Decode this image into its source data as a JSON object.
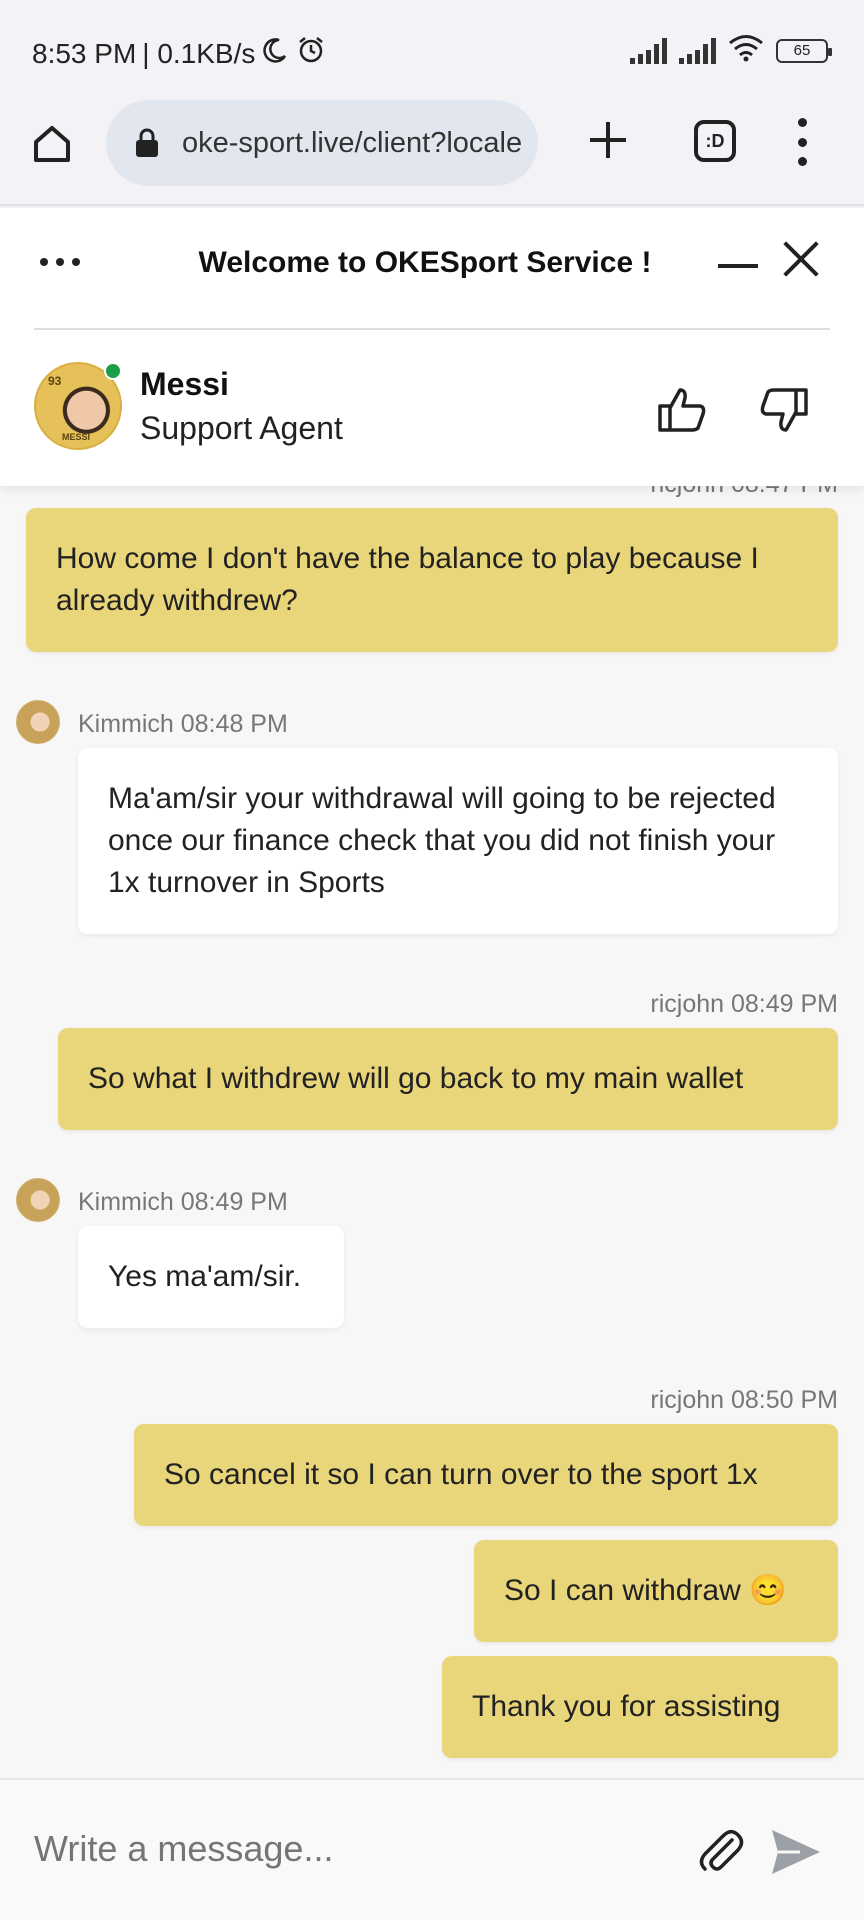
{
  "status_bar": {
    "time": "8:53 PM",
    "speed": "| 0.1KB/s",
    "battery": "65"
  },
  "browser": {
    "url": "oke-sport.live/client?locale",
    "tabs_label": ":D"
  },
  "chat_header": {
    "title": "Welcome to OKESport Service !",
    "agent_name": "Messi",
    "agent_role": "Support Agent",
    "agent_card_number": "93",
    "agent_card_name": "MESSI",
    "online_color": "#1a9e48"
  },
  "messages": {
    "partial_meta": "ricjohn 08:47 PM",
    "m1_text": "How come I don't have the balance to play because I already withdrew?",
    "m2_meta": "Kimmich 08:48 PM",
    "m2_text": "Ma'am/sir your withdrawal will going to be rejected once our finance check that you did not finish your 1x turnover in Sports",
    "m3_meta": "ricjohn 08:49 PM",
    "m3_text": "So what I withdrew will go back to my main wallet",
    "m4_meta": "Kimmich 08:49 PM",
    "m4_text": "Yes ma'am/sir.",
    "m5_meta": "ricjohn 08:50 PM",
    "m5_text": "So cancel it so I can turn over to the sport 1x",
    "m6_text": "So I can withdraw 😊",
    "m7_text": "Thank you for assisting"
  },
  "input": {
    "placeholder": "Write a message..."
  },
  "colors": {
    "my_bubble": "#e9d57a",
    "their_bubble": "#ffffff"
  }
}
